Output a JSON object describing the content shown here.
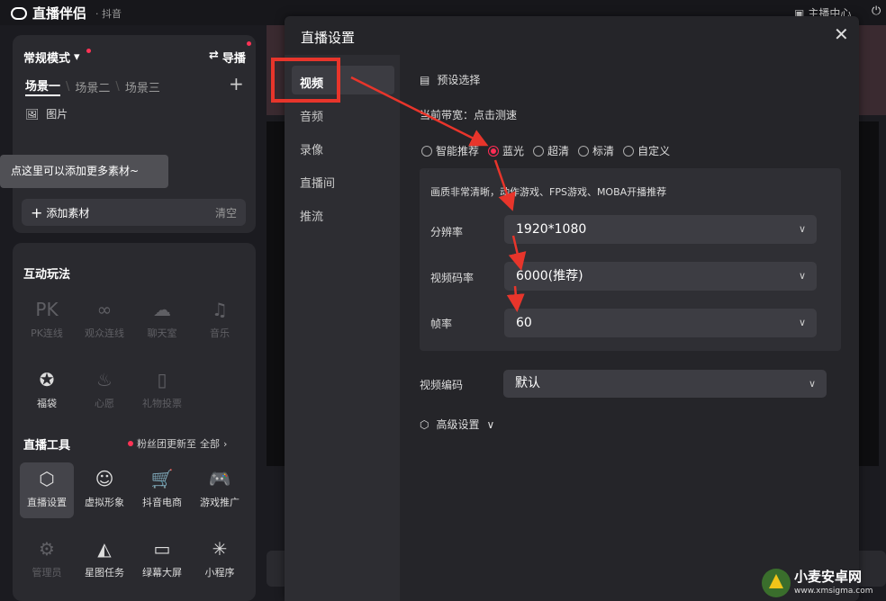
{
  "topbar": {
    "app_name": "直播伴侣",
    "app_sub": "· 抖音",
    "anchor_center": "主播中心"
  },
  "scene_panel": {
    "mode": "常规模式",
    "guide": "导播",
    "scenes": [
      "场景一",
      "场景二",
      "场景三"
    ],
    "picture_item": "图片",
    "tooltip": "点这里可以添加更多素材~",
    "add_material": "添加素材",
    "clear": "清空"
  },
  "interact": {
    "title": "互动玩法",
    "items": [
      {
        "label": "PK连线",
        "icon": "pk-icon",
        "glyph": "PK"
      },
      {
        "label": "观众连线",
        "icon": "link-icon",
        "glyph": "∞"
      },
      {
        "label": "聊天室",
        "icon": "chat-icon",
        "glyph": "☁"
      },
      {
        "label": "音乐",
        "icon": "music-icon",
        "glyph": "♫"
      },
      {
        "label": "福袋",
        "icon": "lucky-bag-icon",
        "glyph": "✪"
      },
      {
        "label": "心愿",
        "icon": "wish-icon",
        "glyph": "♨"
      },
      {
        "label": "礼物投票",
        "icon": "vote-icon",
        "glyph": "▯"
      }
    ]
  },
  "tools": {
    "title": "直播工具",
    "fans_notice": "粉丝团更新至",
    "all": "全部",
    "items": [
      {
        "label": "直播设置",
        "icon": "settings-hex-icon",
        "glyph": "⬡"
      },
      {
        "label": "虚拟形象",
        "icon": "avatar-icon",
        "glyph": "☺"
      },
      {
        "label": "抖音电商",
        "icon": "cart-icon",
        "glyph": "🛒"
      },
      {
        "label": "游戏推广",
        "icon": "gamepad-icon",
        "glyph": "🎮"
      },
      {
        "label": "管理员",
        "icon": "admin-icon",
        "glyph": "⚙"
      },
      {
        "label": "星图任务",
        "icon": "star-task-icon",
        "glyph": "◭"
      },
      {
        "label": "绿幕大屏",
        "icon": "screen-icon",
        "glyph": "▭"
      },
      {
        "label": "小程序",
        "icon": "mini-program-icon",
        "glyph": "✳"
      }
    ]
  },
  "dialog": {
    "title": "直播设置",
    "tabs": [
      "视频",
      "音频",
      "录像",
      "直播间",
      "推流"
    ],
    "preset_label": "预设选择",
    "bandwidth": "当前带宽：点击测速",
    "presets": [
      "智能推荐",
      "蓝光",
      "超清",
      "标清",
      "自定义"
    ],
    "selected_preset": "蓝光",
    "note": "画质非常清晰，动作游戏、FPS游戏、MOBA开播推荐",
    "resolution_label": "分辨率",
    "resolution": "1920*1080",
    "bitrate_label": "视频码率",
    "bitrate": "6000(推荐)",
    "fps_label": "帧率",
    "fps": "60",
    "encoder_label": "视频编码",
    "encoder": "默认",
    "advanced": "高级设置"
  },
  "watermark": {
    "title": "小麦安卓网",
    "url": "www.xmsigma.com"
  },
  "colors": {
    "accent": "#ff2d55",
    "annotation": "#e8352b"
  }
}
